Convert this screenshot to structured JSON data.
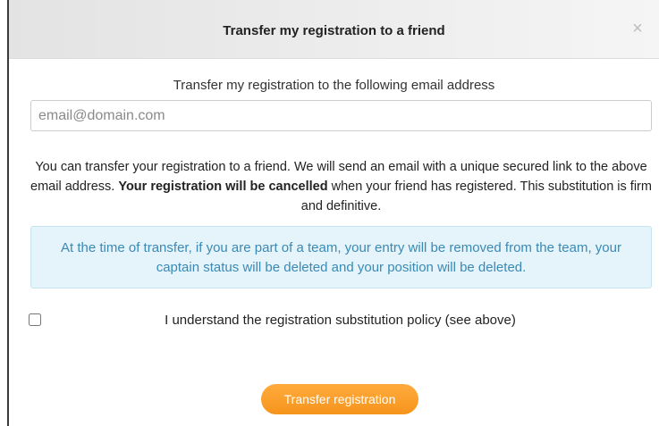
{
  "modal": {
    "title": "Transfer my registration to a friend",
    "close_glyph": "×"
  },
  "form": {
    "email_label": "Transfer my registration to the following email address",
    "email_placeholder": "email@domain.com",
    "email_value": ""
  },
  "description": {
    "part1": "You can transfer your registration to a friend. We will send an email with a unique secured link to the above email address. ",
    "bold": "Your registration will be cancelled",
    "part2": " when your friend has registered. This substitution is firm and definitive."
  },
  "alert": {
    "text": "At the time of transfer, if you are part of a team, your entry will be removed from the team, your captain status will be deleted and your position will be deleted."
  },
  "agreement": {
    "label": "I understand the registration substitution policy (see above)",
    "checked": false
  },
  "submit": {
    "label": "Transfer registration"
  },
  "colors": {
    "button_orange": "#f6941c",
    "alert_background": "#e5f3fa",
    "alert_text": "#3a8ab5"
  }
}
